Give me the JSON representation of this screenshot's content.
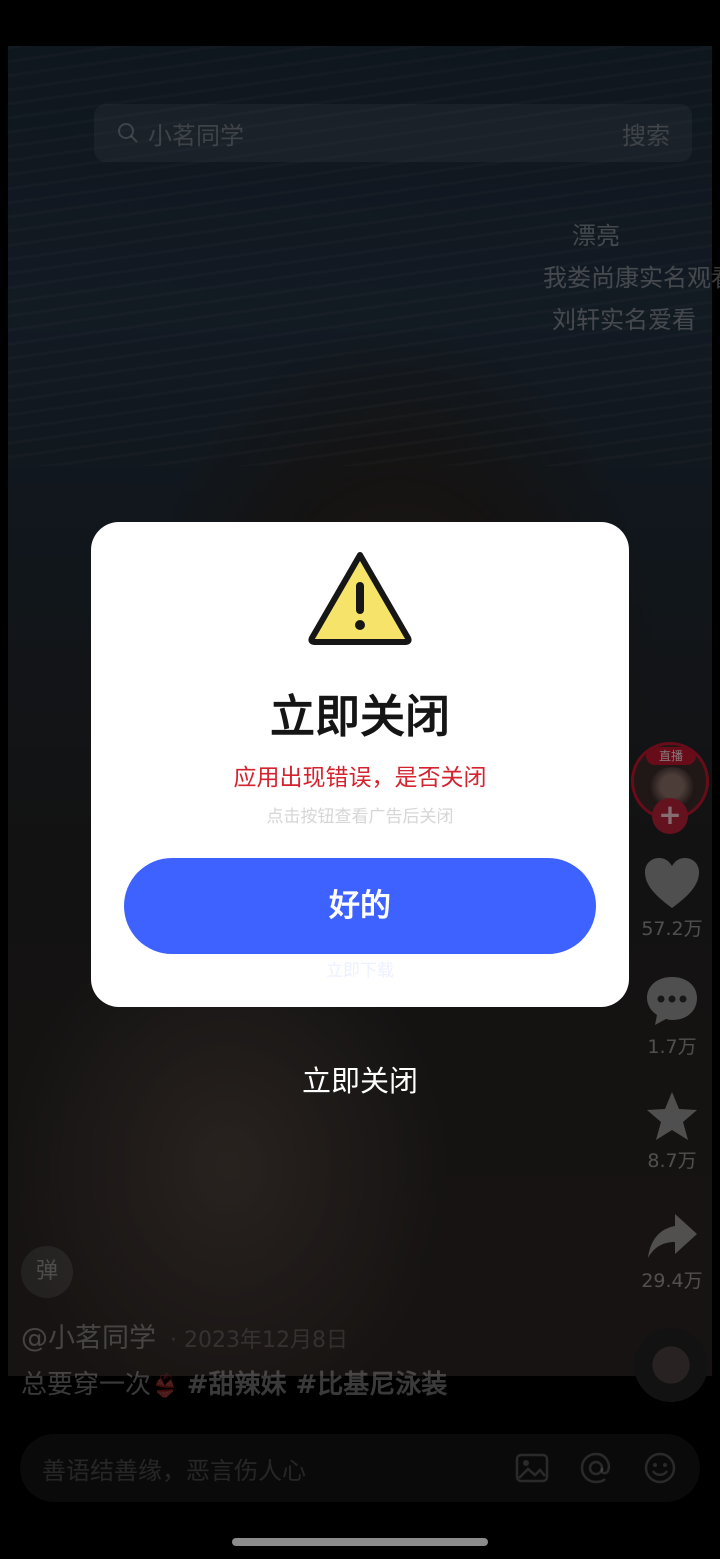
{
  "search": {
    "placeholder": "小茗同学",
    "button": "搜索"
  },
  "danmu": [
    "漂亮",
    "我娄尚康实名观看",
    "刘轩实名爱看"
  ],
  "rail": {
    "likes": "57.2万",
    "comments": "1.7万",
    "favorites": "8.7万",
    "shares": "29.4万",
    "live_tag": "直播",
    "follow": "+"
  },
  "video": {
    "danmu_toggle": "弹",
    "author": "@小茗同学",
    "date": "· 2023年12月8日",
    "caption_text": "总要穿一次",
    "caption_emoji": "👙",
    "tags": "#甜辣妹 #比基尼泳装"
  },
  "comment_bar": {
    "placeholder": "善语结善缘，恶言伤人心"
  },
  "dialog": {
    "title": "立即关闭",
    "subtitle": "应用出现错误，是否关闭",
    "hint": "点击按钮查看广告后关闭",
    "ok_label": "好的",
    "ghost": "立即下载",
    "accent": "#3e62ff",
    "warning_color": "#f6e36a"
  },
  "close_link": "立即关闭"
}
